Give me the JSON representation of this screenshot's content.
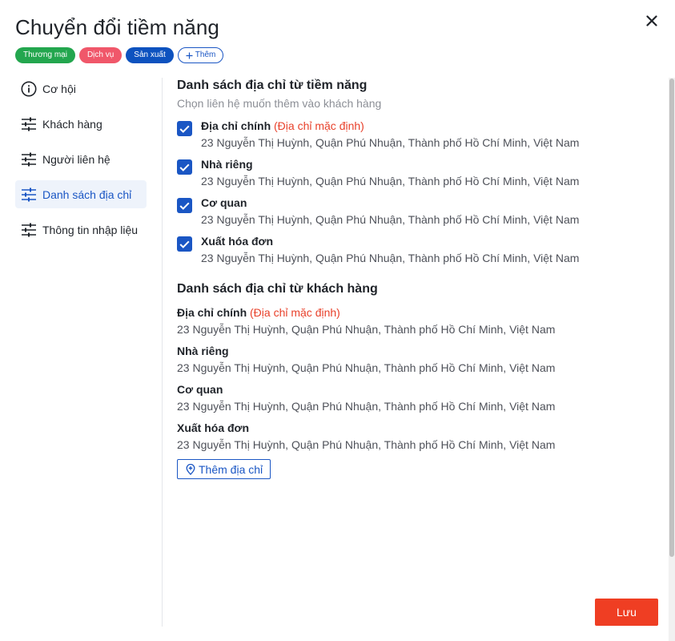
{
  "dialog": {
    "title": "Chuyển đổi tiềm năng"
  },
  "tags": [
    {
      "label": "Thương mại",
      "color": "#23a64e"
    },
    {
      "label": "Dịch vụ",
      "color": "#f0576a"
    },
    {
      "label": "Sản xuất",
      "color": "#0d52bf"
    }
  ],
  "add_tag_label": "Thêm",
  "sidebar": {
    "items": [
      {
        "label": "Cơ hội",
        "icon": "info-icon"
      },
      {
        "label": "Khách hàng",
        "icon": "sliders-icon"
      },
      {
        "label": "Người liên hệ",
        "icon": "sliders-icon"
      },
      {
        "label": "Danh sách địa chỉ",
        "icon": "sliders-icon",
        "active": true
      },
      {
        "label": "Thông tin nhập liệu",
        "icon": "sliders-icon"
      }
    ]
  },
  "lead_addresses": {
    "title": "Danh sách địa chỉ từ tiềm năng",
    "subtitle": "Chọn liên hệ muốn thêm vào khách hàng",
    "items": [
      {
        "name": "Địa chỉ chính",
        "default_label": "(Địa chỉ mặc định)",
        "address": "23 Nguyễn Thị Huỳnh, Quận Phú Nhuận, Thành phố Hồ Chí Minh, Việt Nam",
        "checked": true
      },
      {
        "name": "Nhà riêng",
        "default_label": "",
        "address": "23 Nguyễn Thị Huỳnh, Quận Phú Nhuận, Thành phố Hồ Chí Minh, Việt Nam",
        "checked": true
      },
      {
        "name": "Cơ quan",
        "default_label": "",
        "address": "23 Nguyễn Thị Huỳnh, Quận Phú Nhuận, Thành phố Hồ Chí Minh, Việt Nam",
        "checked": true
      },
      {
        "name": "Xuất hóa đơn",
        "default_label": "",
        "address": "23 Nguyễn Thị Huỳnh, Quận Phú Nhuận, Thành phố Hồ Chí Minh, Việt Nam",
        "checked": true
      }
    ]
  },
  "customer_addresses": {
    "title": "Danh sách địa chỉ từ khách hàng",
    "items": [
      {
        "name": "Địa chỉ chính",
        "default_label": "(Địa chỉ mặc định)",
        "address": "23 Nguyễn Thị Huỳnh, Quận Phú Nhuận, Thành phố Hồ Chí Minh, Việt Nam"
      },
      {
        "name": "Nhà riêng",
        "default_label": "",
        "address": "23 Nguyễn Thị Huỳnh, Quận Phú Nhuận, Thành phố Hồ Chí Minh, Việt Nam"
      },
      {
        "name": "Cơ quan",
        "default_label": "",
        "address": "23 Nguyễn Thị Huỳnh, Quận Phú Nhuận, Thành phố Hồ Chí Minh, Việt Nam"
      },
      {
        "name": "Xuất hóa đơn",
        "default_label": "",
        "address": "23 Nguyễn Thị Huỳnh, Quận Phú Nhuận, Thành phố Hồ Chí Minh, Việt Nam"
      }
    ],
    "add_button_label": "Thêm địa chỉ"
  },
  "footer": {
    "save_label": "Lưu"
  },
  "colors": {
    "accent": "#1a56c4",
    "danger": "#ef3e23",
    "default_tag": "#e8402a"
  }
}
